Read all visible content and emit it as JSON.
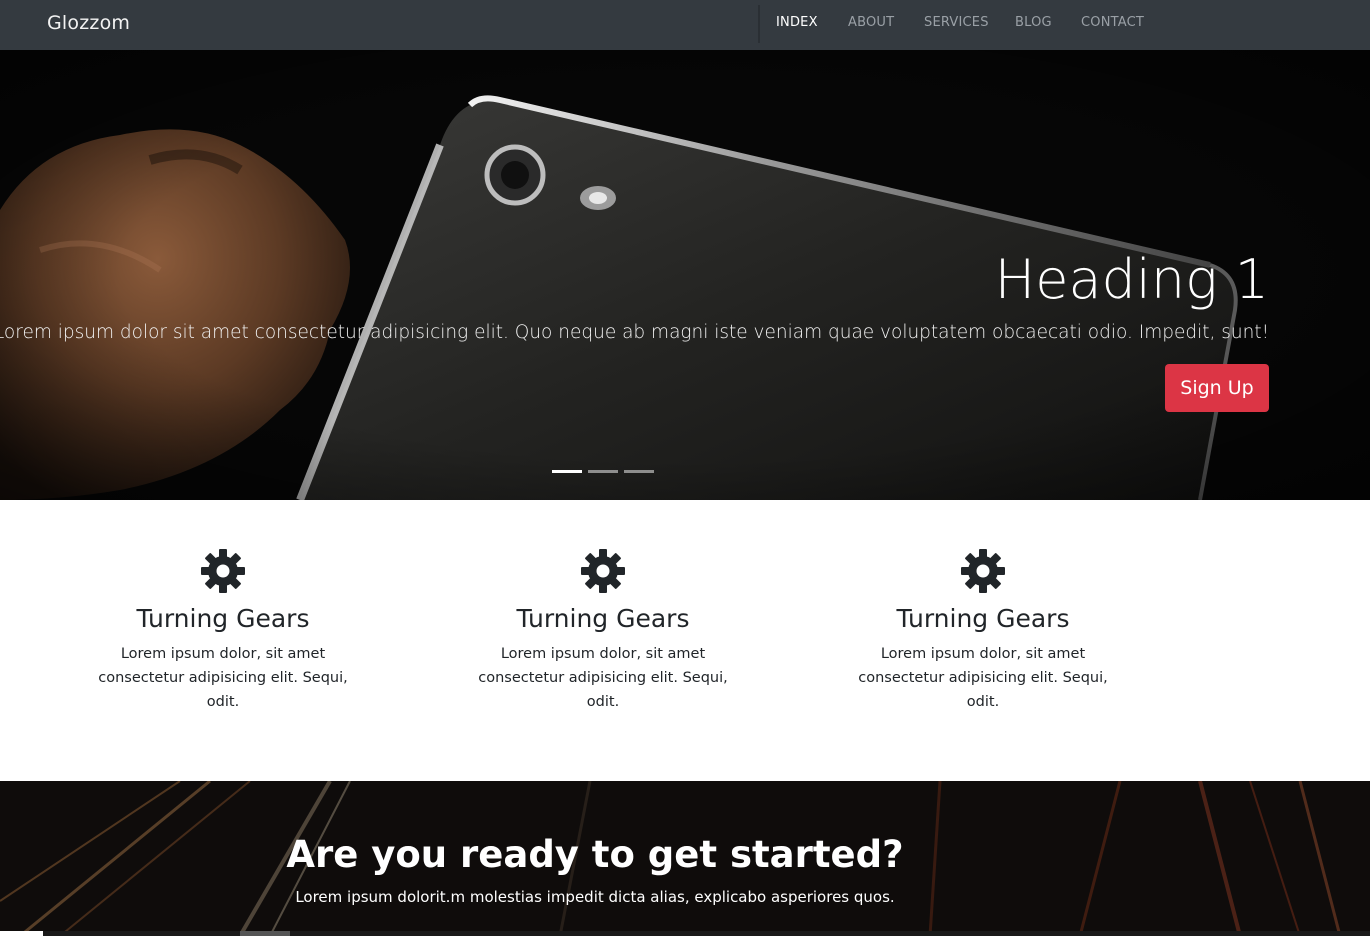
{
  "navbar": {
    "brand": "Glozzom",
    "links": [
      "INDEX",
      "ABOUT",
      "SERVICES",
      "BLOG",
      "CONTACT"
    ],
    "active_link": "INDEX"
  },
  "hero": {
    "heading": "Heading 1",
    "text": "Lorem ipsum dolor sit amet consectetur adipisicing elit. Quo neque ab magni iste veniam quae voluptatem obcaecati odio. Impedit, sunt!",
    "button_label": "Sign Up",
    "slide_count": 3,
    "active_slide": 1
  },
  "features": [
    {
      "icon": "gear-icon",
      "title": "Turning Gears",
      "text": "Lorem ipsum dolor, sit amet consectetur adipisicing elit. Sequi, odit."
    },
    {
      "icon": "gear-icon",
      "title": "Turning Gears",
      "text": "Lorem ipsum dolor, sit amet consectetur adipisicing elit. Sequi, odit."
    },
    {
      "icon": "gear-icon",
      "title": "Turning Gears",
      "text": "Lorem ipsum dolor, sit amet consectetur adipisicing elit. Sequi, odit."
    }
  ],
  "cta": {
    "heading": "Are you ready to get started?",
    "text": "Lorem ipsum dolorit.m molestias impedit dicta alias, explicabo asperiores quos."
  },
  "colors": {
    "navbar_bg": "#343a40",
    "accent_button": "#dc3545",
    "text_dark": "#212529"
  }
}
